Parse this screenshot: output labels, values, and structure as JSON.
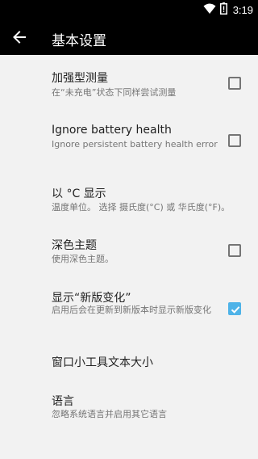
{
  "status_bar": {
    "time": "3:19",
    "icons": [
      "wifi-icon",
      "battery-alert-icon"
    ]
  },
  "app_bar": {
    "title": "基本设置",
    "back_icon": "arrow-back-icon"
  },
  "colors": {
    "app_bar": "#000000",
    "background": "#f2f2f2",
    "accent": "#4fb3e8"
  },
  "settings": [
    {
      "title": "加强型测量",
      "summary": "在“未充电”状态下同样尝试测量",
      "checkbox": true,
      "checked": false
    },
    {
      "title": "Ignore battery health",
      "summary": "Ignore persistent battery health error",
      "checkbox": true,
      "checked": false
    },
    {
      "title": "以 °C 显示",
      "summary": "温度单位。 选择 摄氏度(°C) 或 华氏度(°F)。",
      "checkbox": false
    },
    {
      "title": "深色主题",
      "summary": "使用深色主题。",
      "checkbox": true,
      "checked": false
    },
    {
      "title": "显示“新版变化”",
      "summary": "启用后会在更新到新版本时显示新版变化",
      "checkbox": true,
      "checked": true
    },
    {
      "title": "窗口小工具文本大小",
      "summary": "",
      "checkbox": false
    },
    {
      "title": "语言",
      "summary": "忽略系统语言并启用其它语言",
      "checkbox": false
    }
  ]
}
